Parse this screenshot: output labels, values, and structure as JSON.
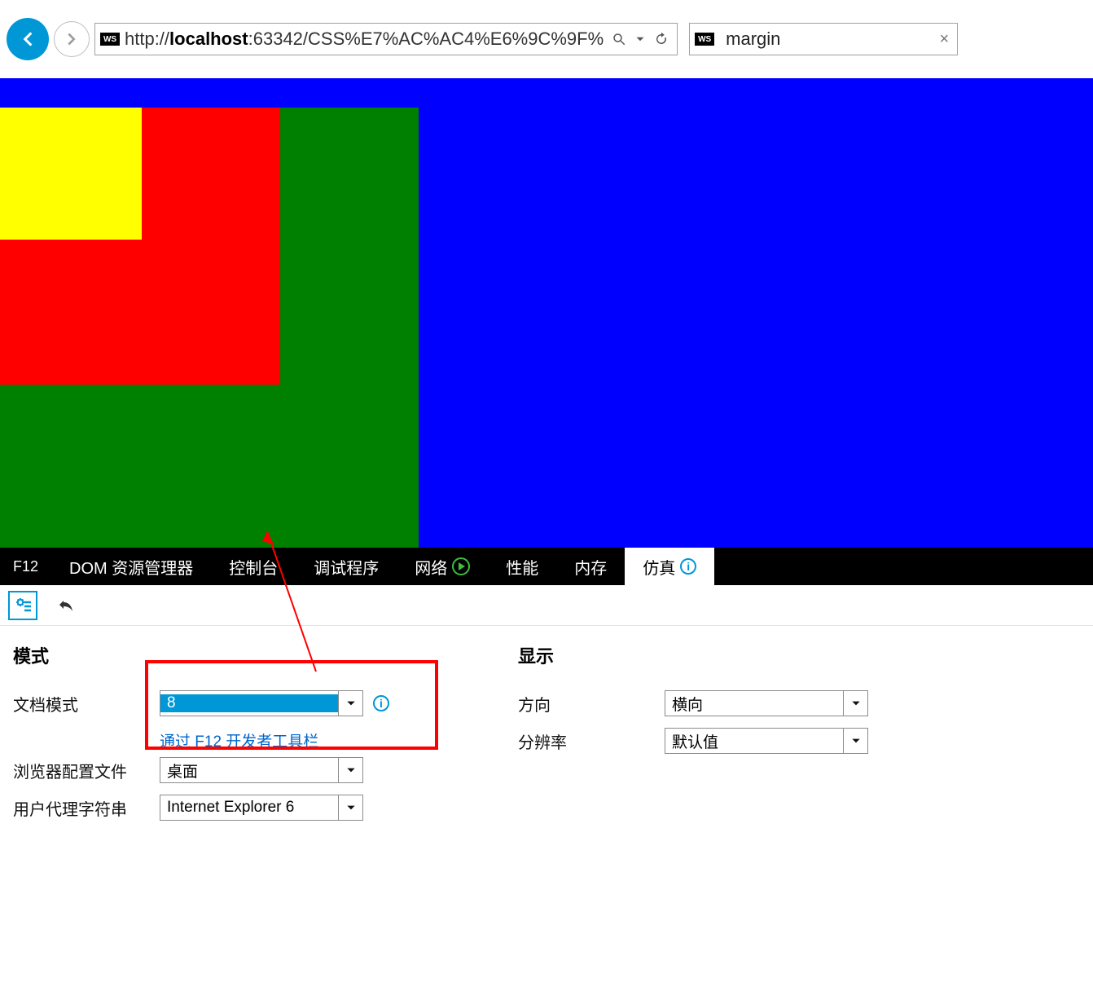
{
  "browser": {
    "ws_icon": "WS",
    "url_prefix": "http://",
    "url_host": "localhost",
    "url_rest": ":63342/CSS%E7%AC%AC4%E6%9C%9F%",
    "tab_title": "margin"
  },
  "devtools": {
    "f12": "F12",
    "tabs": [
      {
        "label": "DOM 资源管理器",
        "id": "dom-explorer"
      },
      {
        "label": "控制台",
        "id": "console"
      },
      {
        "label": "调试程序",
        "id": "debugger"
      },
      {
        "label": "网络",
        "id": "network",
        "icon": "play"
      },
      {
        "label": "性能",
        "id": "performance"
      },
      {
        "label": "内存",
        "id": "memory"
      },
      {
        "label": "仿真",
        "id": "emulation",
        "active": true,
        "icon": "info"
      }
    ]
  },
  "emulation": {
    "mode_title": "模式",
    "doc_mode_label": "文档模式",
    "doc_mode_value": "8",
    "doc_mode_hint": "通过 F12 开发者工具栏",
    "browser_profile_label": "浏览器配置文件",
    "browser_profile_value": "桌面",
    "ua_label": "用户代理字符串",
    "ua_value": "Internet Explorer 6",
    "display_title": "显示",
    "direction_label": "方向",
    "direction_value": "横向",
    "resolution_label": "分辨率",
    "resolution_value": "默认值"
  },
  "info_glyph": "i"
}
